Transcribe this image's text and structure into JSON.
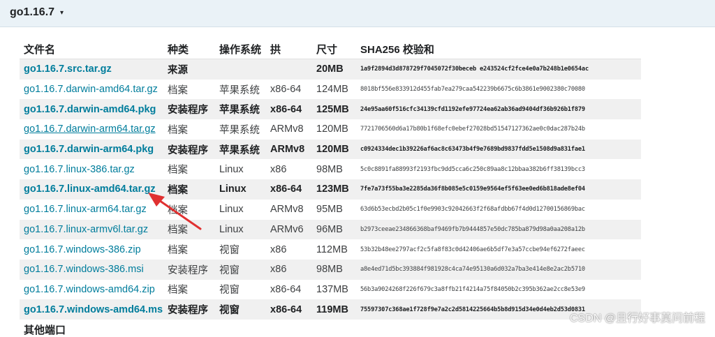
{
  "version": {
    "title": "go1.16.7",
    "caret": "▾"
  },
  "table": {
    "headers": [
      "文件名",
      "种类",
      "操作系统",
      "拱",
      "尺寸",
      "SHA256 校验和"
    ],
    "rows": [
      {
        "file": "go1.16.7.src.tar.gz",
        "kind": "来源",
        "os": "",
        "arch": "",
        "size": "20MB",
        "sha": "1a9f2894d3d878729f7045072f30beceb e243524cf2fce4e0a7b248b1e0654ac",
        "highlight": true
      },
      {
        "file": "go1.16.7.darwin-amd64.tar.gz",
        "kind": "档案",
        "os": "苹果系统",
        "arch": "x86-64",
        "size": "124MB",
        "sha": "8018bf556e833912d455fab7ea279caa542239b6675c6b3861e9002380c70080",
        "highlight": false
      },
      {
        "file": "go1.16.7.darwin-amd64.pkg",
        "kind": "安装程序",
        "os": "苹果系统",
        "arch": "x86-64",
        "size": "125MB",
        "sha": "24e95aa60f516cfc34139cfd1192efe97724ea62ab36ad9404df36b926b1f879",
        "highlight": true
      },
      {
        "file": "go1.16.7.darwin-arm64.tar.gz",
        "kind": "档案",
        "os": "苹果系统",
        "arch": "ARMv8",
        "size": "120MB",
        "sha": "7721706560d6a17b80b1f68efc0ebef27028bd51547127362ae0c0dac287b24b",
        "highlight": false,
        "underline": true
      },
      {
        "file": "go1.16.7.darwin-arm64.pkg",
        "kind": "安装程序",
        "os": "苹果系统",
        "arch": "ARMv8",
        "size": "120MB",
        "sha": "c0924334dec1b39226af6ac8c63473b4f9e7689bd9837fdd5e1508d9a831fae1",
        "highlight": true
      },
      {
        "file": "go1.16.7.linux-386.tar.gz",
        "kind": "档案",
        "os": "Linux",
        "arch": "x86",
        "size": "98MB",
        "sha": "5c0c8891fa88993f2193fbc9dd5cca6c250c89aa8c12bbaa382b6ff38139bcc3",
        "highlight": false
      },
      {
        "file": "go1.16.7.linux-amd64.tar.gz",
        "kind": "档案",
        "os": "Linux",
        "arch": "x86-64",
        "size": "123MB",
        "sha": "7fe7a73f55ba3e2285da36f8b085e5c0159e9564ef5f63ee0ed6b818ade8ef04",
        "highlight": true
      },
      {
        "file": "go1.16.7.linux-arm64.tar.gz",
        "kind": "档案",
        "os": "Linux",
        "arch": "ARMv8",
        "size": "95MB",
        "sha": "63d6b53ecbd2b05c1f0e9903c92042663f2f68afdbb67f4d0d12700156869bac",
        "highlight": false
      },
      {
        "file": "go1.16.7.linux-armv6l.tar.gz",
        "kind": "档案",
        "os": "Linux",
        "arch": "ARMv6",
        "size": "96MB",
        "sha": "b2973ceeae234866368baf9469fb7b9444857e50dc785ba879d98a0aa208a12b",
        "highlight": false
      },
      {
        "file": "go1.16.7.windows-386.zip",
        "kind": "档案",
        "os": "视窗",
        "arch": "x86",
        "size": "112MB",
        "sha": "53b32b48ee2797acf2c5fa8f83c0d42406ae6b5df7e3a57ccbe94ef6272faeec",
        "highlight": false
      },
      {
        "file": "go1.16.7.windows-386.msi",
        "kind": "安装程序",
        "os": "视窗",
        "arch": "x86",
        "size": "98MB",
        "sha": "a8e4ed71d5bc393884f981928c4ca74e95130a6d032a7ba3e414e8e2ac2b5710",
        "highlight": false
      },
      {
        "file": "go1.16.7.windows-amd64.zip",
        "kind": "档案",
        "os": "视窗",
        "arch": "x86-64",
        "size": "137MB",
        "sha": "56b3a9024268f226f679c3a8ffb21f4214a75f84050b2c395b362ae2cc8e53e9",
        "highlight": false
      },
      {
        "file": "go1.16.7.windows-amd64.msi",
        "kind": "安装程序",
        "os": "视窗",
        "arch": "x86-64",
        "size": "119MB",
        "sha": "75597307c368ae1f728f9e7a2c2d5814225664b5b8d915d34e0d4eb2d53d0831",
        "highlight": true
      }
    ]
  },
  "footer": {
    "other_ports": "其他端口"
  },
  "watermark": "CSDN @且行好事莫问前程",
  "colors": {
    "link": "#007d9c",
    "annotation_arrow": "#e03131",
    "header_band": "#eaf2f7"
  }
}
